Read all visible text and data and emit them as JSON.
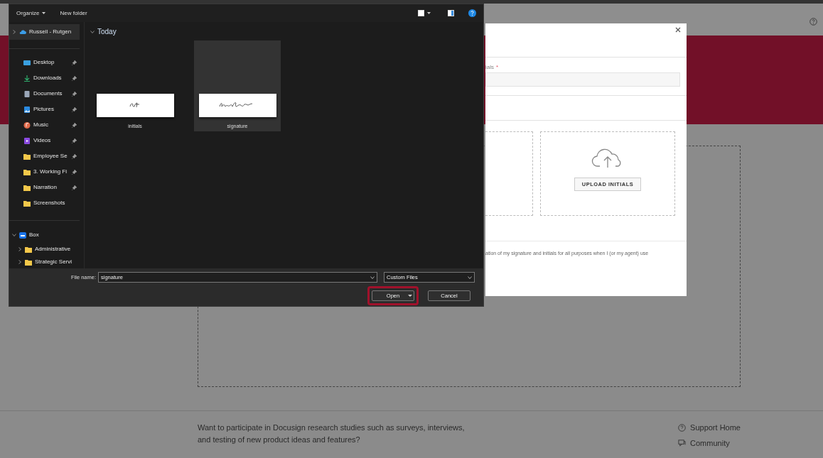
{
  "footer": {
    "research_text": "Want to participate in Docusign research studies such as surveys, interviews, and testing of new product ideas and features?",
    "links": [
      {
        "kind": "help",
        "label": "Support Home"
      },
      {
        "kind": "chat",
        "label": "Community"
      }
    ]
  },
  "modal": {
    "field_label": "ials",
    "required_mark": "*",
    "upload_button": "UPLOAD INITIALS",
    "consent_text": "ation of my signature and initials for all purposes when I (or my agent) use"
  },
  "file_dialog": {
    "toolbar": {
      "organize": "Organize",
      "new_folder": "New folder"
    },
    "nav": [
      {
        "kind": "cloud",
        "label": "Russell - Rutgen",
        "selected": true,
        "expanded": false,
        "pinned": false
      },
      {
        "kind": "desktop",
        "label": "Desktop",
        "selected": false,
        "pinned": true
      },
      {
        "kind": "downloads",
        "label": "Downloads",
        "selected": false,
        "pinned": true
      },
      {
        "kind": "documents",
        "label": "Documents",
        "selected": false,
        "pinned": true
      },
      {
        "kind": "pictures",
        "label": "Pictures",
        "selected": false,
        "pinned": true
      },
      {
        "kind": "music",
        "label": "Music",
        "selected": false,
        "pinned": true
      },
      {
        "kind": "videos",
        "label": "Videos",
        "selected": false,
        "pinned": true
      },
      {
        "kind": "folder",
        "label": "Employee Se",
        "selected": false,
        "pinned": true
      },
      {
        "kind": "folder",
        "label": "3. Working Fi",
        "selected": false,
        "pinned": true
      },
      {
        "kind": "folder",
        "label": "Narration",
        "selected": false,
        "pinned": true
      },
      {
        "kind": "folder",
        "label": "Screenshots",
        "selected": false,
        "pinned": false
      },
      {
        "kind": "box",
        "label": "Box",
        "selected": false,
        "expanded": true,
        "pinned": false,
        "children": [
          {
            "kind": "folder",
            "label": "Administrative",
            "selected": false,
            "expanded": false,
            "pinned": false
          },
          {
            "kind": "folder",
            "label": "Strategic Servi",
            "selected": false,
            "expanded": false,
            "pinned": false
          }
        ]
      }
    ],
    "group": {
      "label": "Today",
      "expanded": true
    },
    "files": [
      {
        "name": "initials",
        "selected": false
      },
      {
        "name": "signature",
        "selected": true
      }
    ],
    "file_name_label": "File name:",
    "file_name": "signature",
    "file_type": "Custom Files",
    "buttons": [
      {
        "label": "Open",
        "highlighted": true,
        "split": true
      },
      {
        "label": "Cancel",
        "highlighted": false,
        "split": false
      }
    ]
  }
}
